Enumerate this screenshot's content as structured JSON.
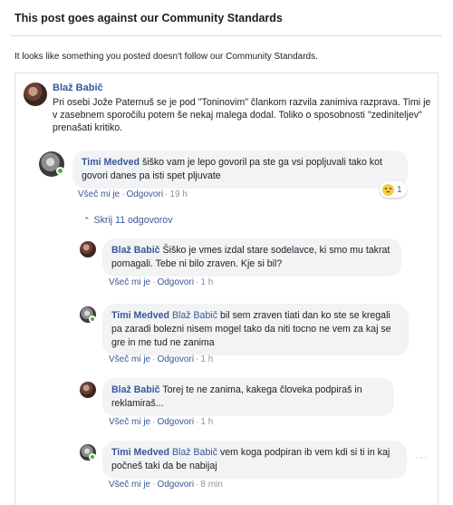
{
  "dialog": {
    "title": "This post goes against our Community Standards",
    "notice": "It looks like something you posted doesn't follow our Community Standards."
  },
  "post": {
    "author": "Blaž Babič",
    "text": "Pri osebi Jože Paternuš se je pod \"Toninovim\" člankom razvila zanimiva razprava. Timi je v zasebnem sporočilu potem še nekaj malega dodal. Toliko o sposobnosti \"zediniteljev\" prenašati kritiko."
  },
  "comment": {
    "author": "Timi Medved",
    "text": "šiško vam je lepo govoril pa ste ga vsi popljuvali tako kot govori danes pa isti spet pljuvate",
    "like": "Všeč mi je",
    "reply": "Odgovori",
    "time": "19 h",
    "reaction_count": "1",
    "reaction_icon": "sad-face-icon"
  },
  "hide_replies": {
    "label": "Skrij 11 odgovorov"
  },
  "replies": [
    {
      "author": "Blaž Babič",
      "mention": "",
      "text": "Šiško je vmes izdal stare sodelavce, ki smo mu takrat pomagali. Tebe ni bilo zraven. Kje si bil?",
      "like": "Všeč mi je",
      "reply": "Odgovori",
      "time": "1 h"
    },
    {
      "author": "Timi Medved",
      "mention": "Blaž Babič",
      "text": "bil sem zraven tiati dan ko ste se kregali pa zaradi bolezni nisem mogel tako da niti tocno ne vem za kaj se gre in me tud ne zanima",
      "like": "Všeč mi je",
      "reply": "Odgovori",
      "time": "1 h"
    },
    {
      "author": "Blaž Babič",
      "mention": "",
      "text": "Torej te ne zanima, kakega človeka podpiraš in reklamiraš...",
      "like": "Všeč mi je",
      "reply": "Odgovori",
      "time": "1 h"
    },
    {
      "author": "Timi Medved",
      "mention": "Blaž Babič",
      "text": "vem koga podpiran ib vem kdi si ti in kaj počneš taki da be nabijaj",
      "like": "Všeč mi je",
      "reply": "Odgovori",
      "time": "8 min"
    }
  ],
  "colors": {
    "link": "#385898",
    "bubble": "#f2f3f5",
    "online": "#42b72a",
    "meta": "#90949c"
  }
}
